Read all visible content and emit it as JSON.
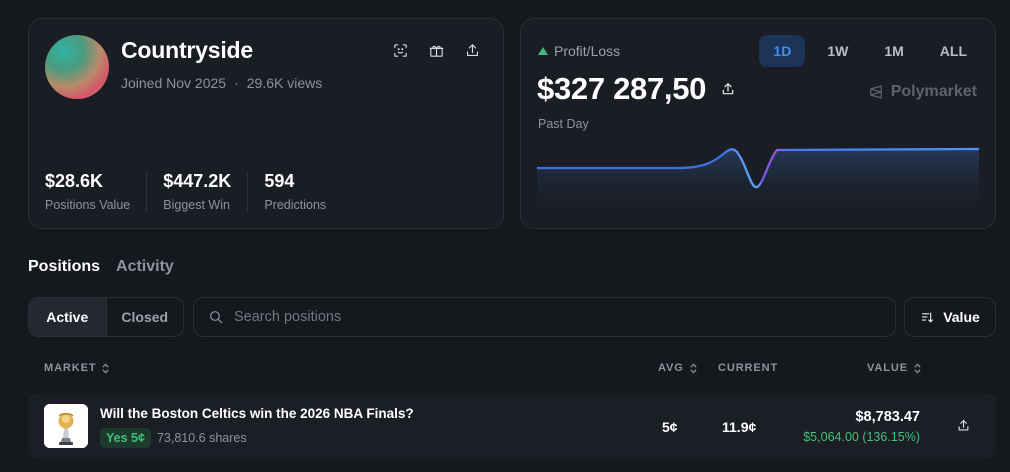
{
  "profile": {
    "name": "Countryside",
    "joined": "Joined Nov 2025",
    "separator": "·",
    "views": "29.6K views",
    "stats": [
      {
        "value": "$28.6K",
        "label": "Positions Value"
      },
      {
        "value": "$447.2K",
        "label": "Biggest Win"
      },
      {
        "value": "594",
        "label": "Predictions"
      }
    ]
  },
  "pnl": {
    "label": "Profit/Loss",
    "value": "$327 287,50",
    "period": "Past Day",
    "brand": "Polymarket",
    "ranges": [
      "1D",
      "1W",
      "1M",
      "ALL"
    ],
    "active_range": "1D",
    "line_color": "#4a83f0"
  },
  "tabs": {
    "positions": "Positions",
    "activity": "Activity"
  },
  "filters": {
    "active": "Active",
    "closed": "Closed",
    "search_placeholder": "Search positions",
    "sort_label": "Value"
  },
  "table": {
    "headers": {
      "market": "MARKET",
      "avg": "AVG",
      "current": "CURRENT",
      "value": "VALUE"
    },
    "rows": [
      {
        "title": "Will the Boston Celtics win the 2026 NBA Finals?",
        "outcome": "Yes 5¢",
        "shares": "73,810.6 shares",
        "avg": "5¢",
        "current": "11.9¢",
        "value": "$8,783.47",
        "pnl": "$5,064.00 (136.15%)"
      }
    ]
  },
  "colors": {
    "accent_blue": "#3b8ef3",
    "gain_green": "#43c07a",
    "background": "#15181d"
  }
}
